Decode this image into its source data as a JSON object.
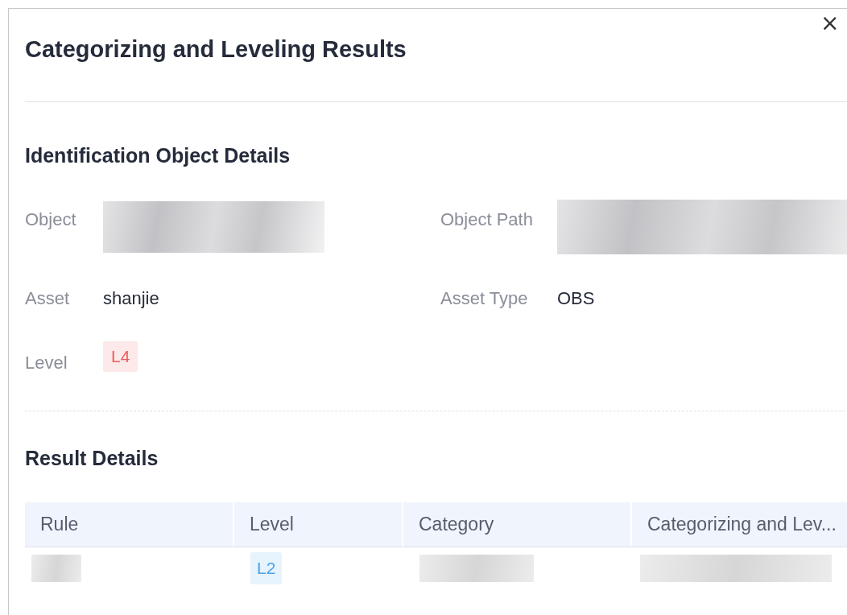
{
  "dialog": {
    "title": "Categorizing and Leveling Results",
    "close": "×"
  },
  "object_details": {
    "title": "Identification Object Details",
    "fields": [
      {
        "label": "Object",
        "kind": "redacted"
      },
      {
        "label": "Object Path",
        "kind": "redacted"
      },
      {
        "label": "Asset",
        "kind": "text",
        "value": "shanjie"
      },
      {
        "label": "Asset Type",
        "kind": "text",
        "value": "OBS"
      },
      {
        "label": "Level",
        "kind": "tag",
        "value": "L4",
        "color": "#f05a5a"
      }
    ]
  },
  "result_details": {
    "title": "Result Details",
    "table": {
      "columns": [
        "Rule",
        "Level",
        "Category",
        "Categorizing and Lev..."
      ],
      "rows": [
        [
          {
            "kind": "redacted"
          },
          {
            "kind": "tag",
            "value": "L2",
            "color": "#4aa3f0"
          },
          {
            "kind": "redacted"
          },
          {
            "kind": "redacted"
          }
        ]
      ]
    }
  }
}
